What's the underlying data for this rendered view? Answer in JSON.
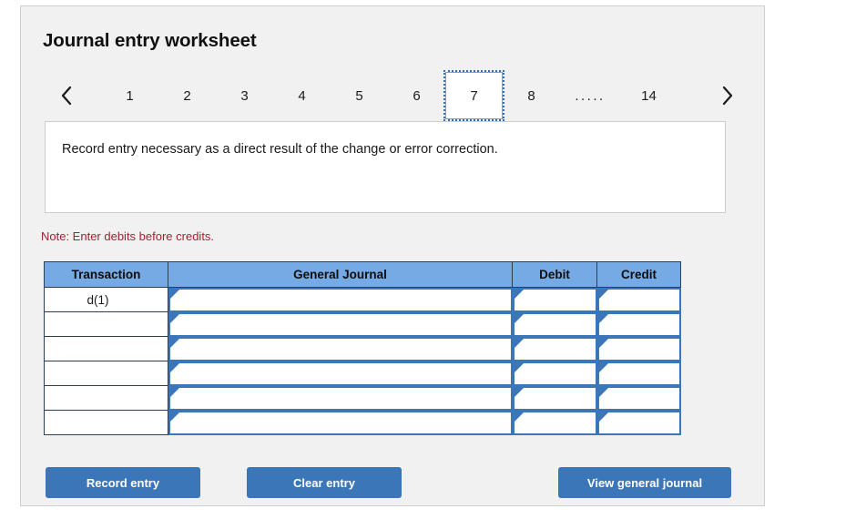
{
  "title": "Journal entry worksheet",
  "pager": {
    "prev_icon": "chevron-left-icon",
    "next_icon": "chevron-right-icon",
    "items": [
      {
        "label": "1",
        "active": false
      },
      {
        "label": "2",
        "active": false
      },
      {
        "label": "3",
        "active": false
      },
      {
        "label": "4",
        "active": false
      },
      {
        "label": "5",
        "active": false
      },
      {
        "label": "6",
        "active": false
      },
      {
        "label": "7",
        "active": true
      },
      {
        "label": "8",
        "active": false
      },
      {
        "label": ".....",
        "active": false,
        "ellipsis": true
      },
      {
        "label": "14",
        "active": false
      }
    ],
    "active_page": "7"
  },
  "instruction": "Record entry necessary as a direct result of the change or error correction.",
  "note": "Note: Enter debits before credits.",
  "table": {
    "headers": [
      "Transaction",
      "General Journal",
      "Debit",
      "Credit"
    ],
    "rows": [
      {
        "transaction": "d(1)",
        "general_journal": "",
        "debit": "",
        "credit": ""
      },
      {
        "transaction": "",
        "general_journal": "",
        "debit": "",
        "credit": ""
      },
      {
        "transaction": "",
        "general_journal": "",
        "debit": "",
        "credit": ""
      },
      {
        "transaction": "",
        "general_journal": "",
        "debit": "",
        "credit": ""
      },
      {
        "transaction": "",
        "general_journal": "",
        "debit": "",
        "credit": ""
      },
      {
        "transaction": "",
        "general_journal": "",
        "debit": "",
        "credit": ""
      }
    ]
  },
  "buttons": {
    "record": "Record entry",
    "clear": "Clear entry",
    "view": "View general journal"
  },
  "colors": {
    "header_blue": "#76aae4",
    "button_blue": "#3a76b8",
    "cell_border_blue": "#3a76b8",
    "note_red": "#a02232",
    "card_bg": "#f1f1f1",
    "active_tab_outline": "#2f6db5"
  }
}
